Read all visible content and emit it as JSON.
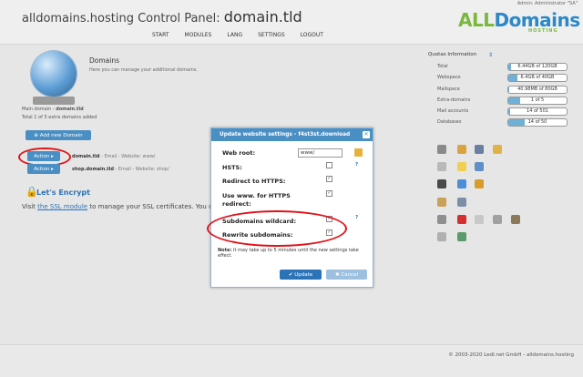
{
  "header": {
    "admin_label": "Admin: Administrator \"SA\"",
    "title_prefix": "alldomains.hosting Control Panel:",
    "title_domain": "domain.tld",
    "nav": [
      "START",
      "MODULES",
      "LANG",
      "SETTINGS",
      "LOGOUT"
    ],
    "logo_all": "ALL",
    "logo_domains": "Domains",
    "logo_sub": "HOSTING",
    "brand_green": "#79b83d",
    "brand_blue": "#2d88c7"
  },
  "domains": {
    "heading": "Domains",
    "description": "Here you can manage your additional domains.",
    "main_domain_label": "Main domain -",
    "main_domain_value": "domain.tld",
    "total": "Total 1 of 5 extra domains added",
    "add_button": "Add new Domain",
    "rows": [
      {
        "action": "Action",
        "domain": "domain.tld",
        "sub": " - Email - Website: www/"
      },
      {
        "action": "Action",
        "domain": "shop.domain.tld",
        "sub": " - Email - Website: shop/"
      }
    ]
  },
  "letsencrypt": {
    "title": "Let's Encrypt",
    "text_before": "Visit ",
    "link": "the SSL module",
    "text_after": " to manage your SSL certificates. You ca"
  },
  "quotas": {
    "title": "Quotas Information",
    "rows": [
      {
        "label": "Total",
        "value": "6.44GB of 120GB",
        "fill": 0.05
      },
      {
        "label": "Webspace",
        "value": "6.4GB of 40GB",
        "fill": 0.16
      },
      {
        "label": "Mailspace",
        "value": "40.98MB of 80GB",
        "fill": 0.01
      },
      {
        "label": "Extra-domains",
        "value": "1 of 5",
        "fill": 0.2
      },
      {
        "label": "Mail accounts",
        "value": "14 of 501",
        "fill": 0.03
      },
      {
        "label": "Databases",
        "value": "14 of 50",
        "fill": 0.28
      }
    ]
  },
  "modal": {
    "title": "Update website settings - f4st3st.download",
    "web_root_label": "Web root:",
    "web_root_value": "www/",
    "hsts_label": "HSTS:",
    "redirect_https_label": "Redirect to HTTPS:",
    "use_www_label": "Use www. for HTTPS redirect:",
    "subdomains_wildcard_label": "Subdomains wildcard:",
    "rewrite_subdomains_label": "Rewrite subdomains:",
    "question_mark": "?",
    "note_bold": "Note:",
    "note_text": " It may take up to 5 minutes until the new settings take effect.",
    "update_button": "Update",
    "cancel_button": "Cancel",
    "hsts_checked": false,
    "redirect_https_checked": true,
    "use_www_checked": true,
    "subdomains_wildcard_checked": true,
    "rewrite_subdomains_checked": true
  },
  "footer": {
    "text": "© 2003-2020 LedI.net GmbH - alldomains.hosting"
  },
  "icon_names": [
    "floppy-icon",
    "calendar-icon",
    "people-icon",
    "smile-icon",
    "strike-icon",
    "lightbulb-icon",
    "user-icon",
    "sheep-icon",
    "globe-icon",
    "lock-icon",
    "pencil-icon",
    "server-icon",
    "database-icon",
    "close-icon",
    "card-icon",
    "db-icon",
    "image-icon",
    "document-icon",
    "search-icon"
  ]
}
